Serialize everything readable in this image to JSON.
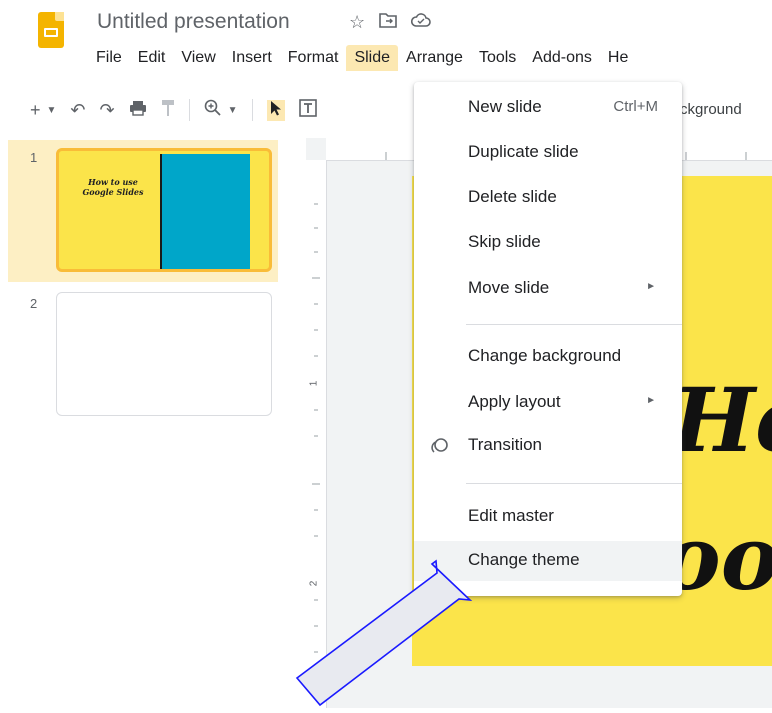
{
  "header": {
    "title": "Untitled presentation",
    "title_icons": [
      "star-icon",
      "folder-move-icon",
      "cloud-status-icon"
    ]
  },
  "menubar": {
    "items": [
      "File",
      "Edit",
      "View",
      "Insert",
      "Format",
      "Slide",
      "Arrange",
      "Tools",
      "Add-ons",
      "He"
    ],
    "active": "Slide"
  },
  "toolbar": {
    "background_label_partial": "ckground"
  },
  "filmstrip": {
    "slides": [
      {
        "number": "1",
        "thumb_text": "How to use Google Slides"
      },
      {
        "number": "2"
      }
    ]
  },
  "ruler": {
    "mark1": "1",
    "mark2": "2"
  },
  "slide": {
    "big_text_line1": "He",
    "big_text_line2": "oo"
  },
  "menu": {
    "items": [
      {
        "label": "New slide",
        "shortcut": "Ctrl+M"
      },
      {
        "label": "Duplicate slide"
      },
      {
        "label": "Delete slide"
      },
      {
        "label": "Skip slide"
      },
      {
        "label": "Move slide",
        "submenu": true
      },
      {
        "label": "Change background"
      },
      {
        "label": "Apply layout",
        "submenu": true
      },
      {
        "label": "Transition",
        "icon": "transition-icon"
      },
      {
        "label": "Edit master"
      },
      {
        "label": "Change theme",
        "highlighted": true
      }
    ]
  },
  "colors": {
    "accent_yellow": "#fbe44a",
    "slide_blue": "#00a6c9",
    "menu_active": "#fce8b2",
    "annotation_arrow": "#1a1aff"
  }
}
